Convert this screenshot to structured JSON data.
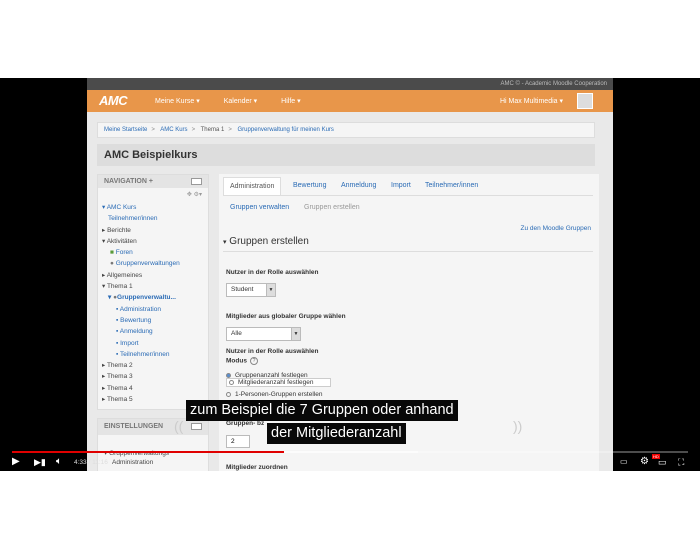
{
  "browser": {
    "topstrip": "AMC © - Academic Moodle Cooperation"
  },
  "navbar": {
    "logo": "AMC",
    "menu": [
      "Meine Kurse ▾",
      "Kalender ▾",
      "Hilfe ▾"
    ],
    "user": "Hi Max Multimedia ▾"
  },
  "breadcrumb": [
    "Meine Startseite",
    "AMC Kurs",
    "Thema 1",
    "Gruppenverwaltung für meinen Kurs"
  ],
  "course_title": "AMC Beispielkurs",
  "navigation": {
    "title": "NAVIGATION",
    "title_plus": "+",
    "items": [
      "AMC Kurs",
      "Teilnehmer/innen",
      "Berichte",
      "Aktivitäten",
      "Foren",
      "Gruppenverwaltungen",
      "Allgemeines",
      "Thema 1",
      "Gruppenverwaltu...",
      "Administration",
      "Bewertung",
      "Anmeldung",
      "Import",
      "Teilnehmer/innen",
      "Thema 2",
      "Thema 3",
      "Thema 4",
      "Thema 5"
    ]
  },
  "settings": {
    "title": "EINSTELLUNGEN",
    "items": [
      "Gruppenverwaltungs",
      "Administration"
    ]
  },
  "tabs": [
    "Administration",
    "Bewertung",
    "Anmeldung",
    "Import",
    "Teilnehmer/innen"
  ],
  "subtabs": [
    "Gruppen verwalten",
    "Gruppen erstellen"
  ],
  "link_right": "Zu den Moodle Gruppen",
  "section": {
    "title": "Gruppen erstellen",
    "role_label": "Nutzer in der Rolle auswählen",
    "role_value": "Student",
    "global_label": "Mitglieder aus globaler Gruppe wählen",
    "global_value": "Alle",
    "modus_label": "Modus",
    "modus_options": [
      "Gruppenanzahl festlegen",
      "Mitgliederanzahl festlegen",
      "1-Personen-Gruppen erstellen"
    ],
    "gruppen_label": "Gruppen- bz",
    "gruppen_value": "2",
    "zuordnen_label": "Mitglieder zuordnen"
  },
  "captions": [
    "zum Beispiel die 7 Gruppen oder anhand",
    "der Mitgliederanzahl"
  ],
  "player": {
    "time": "4:33 / 11:16",
    "progress": 0.403,
    "buffered": 0.6,
    "hd_badge": "HD",
    "progress_color": "#e00000"
  }
}
